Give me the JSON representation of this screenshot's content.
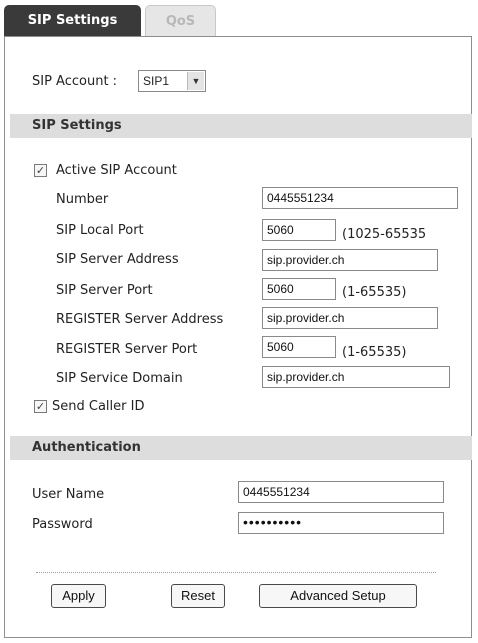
{
  "tabs": [
    {
      "label": "SIP Settings",
      "active": true
    },
    {
      "label": "QoS",
      "active": false
    }
  ],
  "sip_account": {
    "label": "SIP Account :",
    "value": "SIP1"
  },
  "sip_settings": {
    "header": "SIP Settings",
    "active_sip_account": {
      "label": "Active SIP Account",
      "checked": true
    },
    "number": {
      "label": "Number",
      "value": "0445551234"
    },
    "sip_local_port": {
      "label": "SIP Local Port",
      "value": "5060",
      "hint": "(1025-65535"
    },
    "sip_server_address": {
      "label": "SIP Server Address",
      "value": "sip.provider.ch"
    },
    "sip_server_port": {
      "label": "SIP Server Port",
      "value": "5060",
      "hint": "(1-65535)"
    },
    "register_server_address": {
      "label": "REGISTER Server Address",
      "value": "sip.provider.ch"
    },
    "register_server_port": {
      "label": "REGISTER Server Port",
      "value": "5060",
      "hint": "(1-65535)"
    },
    "sip_service_domain": {
      "label": "SIP Service Domain",
      "value": "sip.provider.ch"
    },
    "send_caller_id": {
      "label": "Send Caller ID",
      "checked": true
    }
  },
  "authentication": {
    "header": "Authentication",
    "user_name": {
      "label": "User Name",
      "value": "0445551234"
    },
    "password": {
      "label": "Password",
      "value": "••••••••••"
    }
  },
  "buttons": {
    "apply": "Apply",
    "reset": "Reset",
    "advanced_setup": "Advanced Setup"
  },
  "glyphs": {
    "check": "✓",
    "dropdown_arrow": "▼"
  },
  "colors": {
    "active_tab_bg": "#3a3a3a",
    "section_header_bg": "#dddddd",
    "panel_border": "#8e8e8e"
  }
}
